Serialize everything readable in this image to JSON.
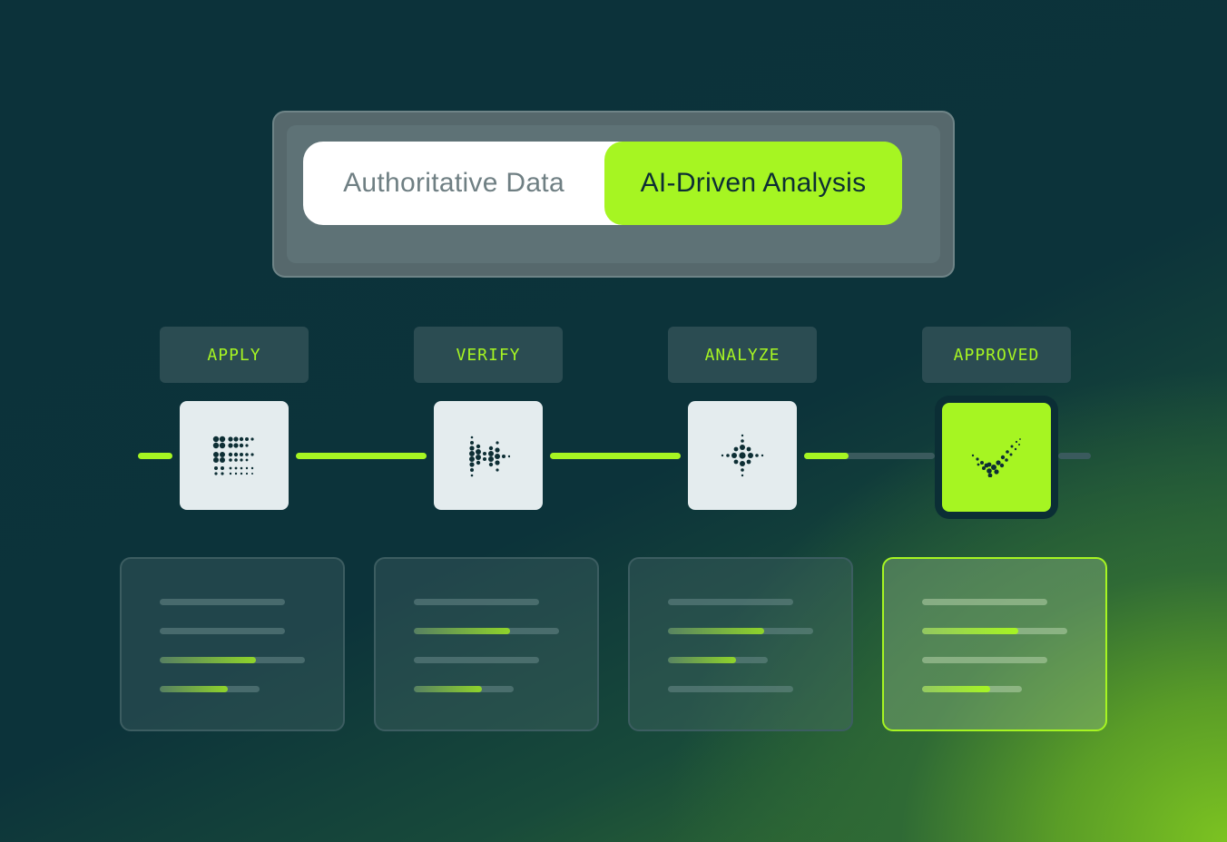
{
  "toggle": {
    "left_label": "Authoritative Data",
    "right_label": "AI-Driven Analysis",
    "selected": "AI-Driven Analysis"
  },
  "steps": [
    {
      "label": "APPLY",
      "icon": "grid-dots-icon"
    },
    {
      "label": "VERIFY",
      "icon": "converge-dots-icon"
    },
    {
      "label": "ANALYZE",
      "icon": "sparkle-dots-icon"
    },
    {
      "label": "APPROVED",
      "icon": "check-dots-icon"
    }
  ],
  "progress": {
    "completed_steps": 3,
    "total_steps": 4
  },
  "colors": {
    "background": "#0c323a",
    "accent": "#a6f522",
    "panel": "#2b4c52",
    "node": "#e4ecee"
  },
  "cards": [
    {
      "bar_fill_fractions": [
        0,
        0,
        0.66,
        0.68
      ]
    },
    {
      "bar_fill_fractions": [
        0,
        0.66,
        0,
        0.68
      ]
    },
    {
      "bar_fill_fractions": [
        0,
        0.66,
        0.68,
        0
      ]
    },
    {
      "bar_fill_fractions": [
        0,
        0.66,
        0,
        0.68
      ]
    }
  ]
}
